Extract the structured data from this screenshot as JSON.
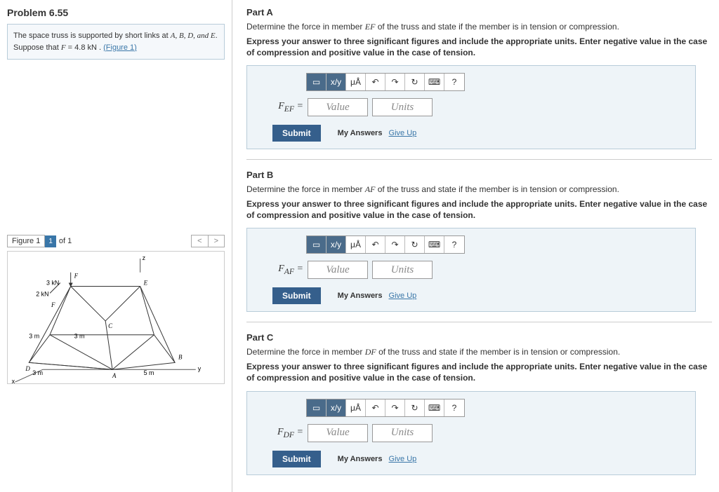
{
  "problem": {
    "title": "Problem 6.55",
    "statement_pre": "The space truss is supported by short links at ",
    "statement_post": ".",
    "pts": "A, B, D, and E",
    "suppose_pre": "Suppose that ",
    "suppose_var": "F",
    "suppose_val": " = 4.8 kN . ",
    "fig_link": "(Figure 1)"
  },
  "figure": {
    "label": "Figure 1",
    "selector": "1",
    "of": "of 1",
    "prev": "<",
    "next": ">",
    "labels": {
      "load3": "3 kN",
      "load2": "2 kN",
      "F1": "F",
      "F2": "F",
      "dim3a": "3 m",
      "dim3b": "3 m",
      "dim3c": "3 m",
      "dim5": "5 m",
      "z": "z",
      "x": "x",
      "y": "y",
      "A": "A",
      "B": "B",
      "C": "C",
      "D": "D",
      "E": "E"
    }
  },
  "toolbar": {
    "tmpl": "▭",
    "frac": "x/y",
    "micro": "μÅ",
    "undo": "↶",
    "redo": "↷",
    "reset": "↻",
    "key": "⌨",
    "help": "?"
  },
  "input": {
    "value_ph": "Value",
    "units_ph": "Units",
    "submit": "Submit",
    "my_answers": "My Answers",
    "give_up": "Give Up"
  },
  "parts": {
    "A": {
      "title": "Part A",
      "desc_pre": "Determine the force in member ",
      "member": "EF",
      "desc_post": " of the truss and state if the member is in tension or compression.",
      "instr": "Express your answer to three significant figures and include the appropriate units. Enter negative value in the case of compression and positive value in the case of tension.",
      "var_label": "F_EF ="
    },
    "B": {
      "title": "Part B",
      "desc_pre": "Determine the force in member ",
      "member": "AF",
      "desc_post": " of the truss and state if the member is in tension or compression.",
      "instr": "Express your answer to three significant figures and include the appropriate units. Enter negative value in the case of compression and positive value in the case of tension.",
      "var_label": "F_AF ="
    },
    "C": {
      "title": "Part C",
      "desc_pre": "Determine the force in member ",
      "member": "DF",
      "desc_post": " of the truss and state if the member is in tension or compression.",
      "instr": "Express your answer to three significant figures and include the appropriate units. Enter negative value in the case of compression and positive value in the case of tension.",
      "var_label": "F_DF ="
    }
  }
}
